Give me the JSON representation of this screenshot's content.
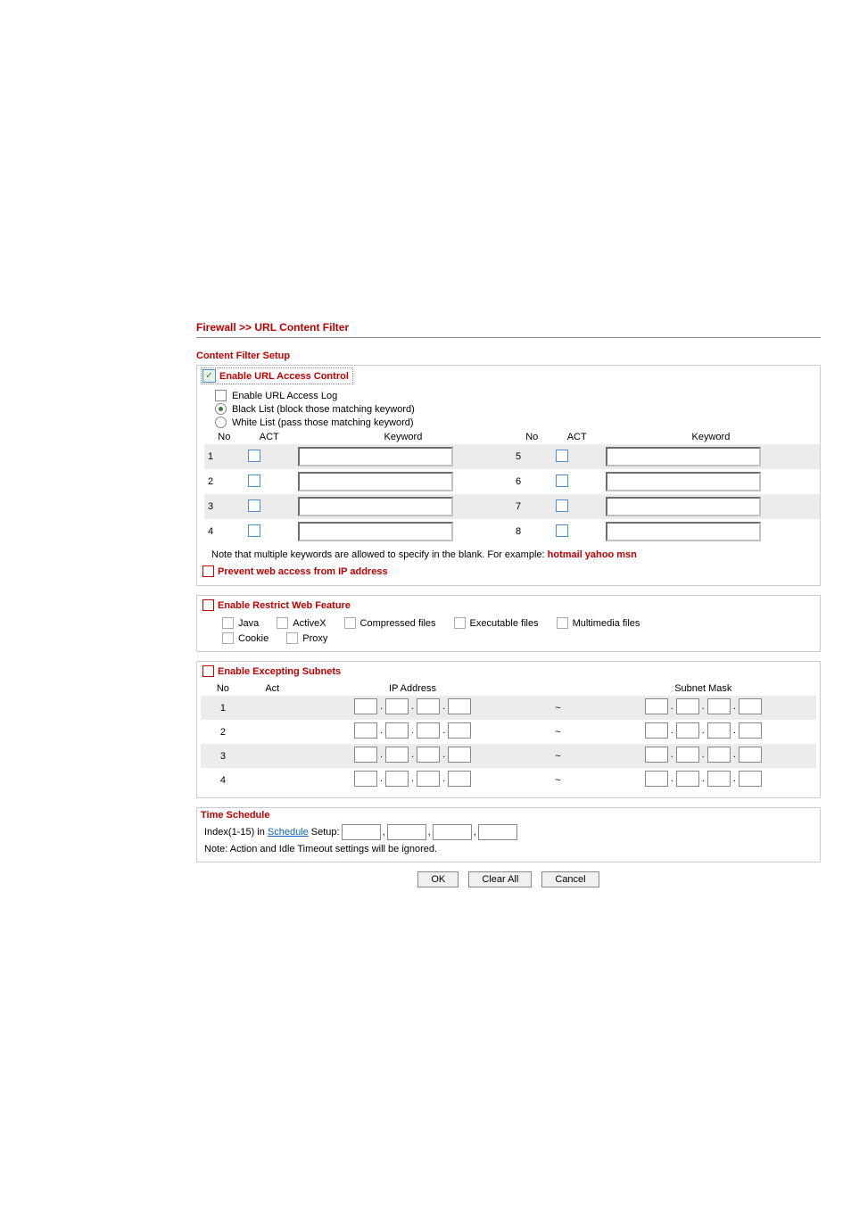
{
  "page_title": "Firewall >> URL Content Filter",
  "setup_heading": "Content Filter Setup",
  "url_access": {
    "enable_label": "Enable URL Access Control",
    "enable_checked": true,
    "log_label": "Enable URL Access Log",
    "black_label": "Black List (block those matching keyword)",
    "white_label": "White List (pass those matching keyword)",
    "head_no": "No",
    "head_act": "ACT",
    "head_kw": "Keyword",
    "rows_left": [
      "1",
      "2",
      "3",
      "4"
    ],
    "rows_right": [
      "5",
      "6",
      "7",
      "8"
    ],
    "note_prefix": "Note that multiple keywords are allowed to specify in the blank. For example: ",
    "note_example": "hotmail yahoo msn",
    "prevent_label": "Prevent web access from IP address"
  },
  "restrict": {
    "enable_label": "Enable Restrict Web Feature",
    "items_row1": [
      "Java",
      "ActiveX",
      "Compressed files",
      "Executable files",
      "Multimedia files"
    ],
    "items_row2": [
      "Cookie",
      "Proxy"
    ]
  },
  "subnets": {
    "enable_label": "Enable Excepting Subnets",
    "head_no": "No",
    "head_act": "Act",
    "head_ip": "IP Address",
    "head_mask": "Subnet Mask",
    "tilde": "~",
    "rows": [
      "1",
      "2",
      "3",
      "4"
    ]
  },
  "schedule": {
    "heading": "Time Schedule",
    "prefix": "Index(1-15) in",
    "link": "Schedule",
    "suffix": "Setup:",
    "comma": ",",
    "note": "Note: Action and Idle Timeout settings will be ignored."
  },
  "buttons": {
    "ok": "OK",
    "clear": "Clear All",
    "cancel": "Cancel"
  }
}
